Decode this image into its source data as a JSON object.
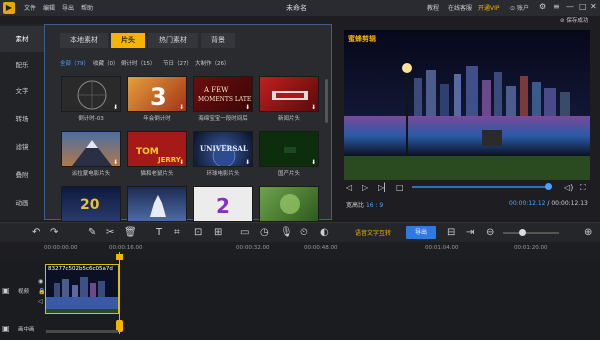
{
  "app": {
    "title": "未命名",
    "menu": [
      "文件",
      "编辑",
      "导出",
      "帮助"
    ],
    "top_right": {
      "tutorial": "教程",
      "online_customer": "在线客服",
      "vip": "开通VIP",
      "account": "账户"
    },
    "save_status": "保存成功"
  },
  "sidebar": {
    "items": [
      "素材",
      "配乐",
      "文字",
      "转场",
      "滤镜",
      "叠附",
      "动画"
    ],
    "active": "素材"
  },
  "library": {
    "tabs": [
      "本地素材",
      "片头",
      "热门素材",
      "背景"
    ],
    "active_tab": "片头",
    "categories": [
      "全部（79）",
      "收藏（0）",
      "倒计时（15）",
      "节日（27）",
      "大制作（26）"
    ],
    "items": [
      {
        "label": "倒计时-03",
        "icon": "circle-countdown-icon"
      },
      {
        "label": "年会倒计时",
        "icon": "number-3-icon"
      },
      {
        "label": "海绵宝宝一段时间后",
        "icon": "title-card-icon"
      },
      {
        "label": "新闻片头",
        "icon": "news-icon"
      },
      {
        "label": "派拉蒙电影片头",
        "icon": "mountain-icon"
      },
      {
        "label": "猫和老鼠片头",
        "icon": "cartoon-icon"
      },
      {
        "label": "环球电影片头",
        "icon": "globe-icon"
      },
      {
        "label": "国产片头",
        "icon": "green-screen-icon"
      },
      {
        "label": "",
        "icon": "20th-century-icon"
      },
      {
        "label": "",
        "icon": "castle-icon"
      },
      {
        "label": "",
        "icon": "number-2-icon"
      },
      {
        "label": "",
        "icon": "nature-icon"
      }
    ],
    "thumb_colors": [
      "#2a2a2a",
      "#c75a2a",
      "#8b1010",
      "#8d1111",
      "#3b3f54",
      "#b21b1b",
      "#1a2a4d",
      "#0f3a0f",
      "#0d1a40",
      "#1d2b52",
      "#e7e7e7",
      "#386b29"
    ]
  },
  "preview": {
    "watermark": "蜜蜂剪辑",
    "ratio_label": "宽高比",
    "ratio": "16 : 9",
    "current_time": "00:00:12.12",
    "total_time": "00:00:12.13",
    "progress": 0.98
  },
  "toolbar": {
    "dub_label": "语音文字互转",
    "export_label": "导出"
  },
  "timeline": {
    "ticks": [
      "00:00:00.00",
      "00:00:16.00",
      "00:00:32.00",
      "00:00:48.00",
      "00:01:04.00",
      "00:01:20.00"
    ],
    "tracks": [
      "视频",
      "画中画"
    ],
    "clip_name": "83277c502b5c6c05a7d",
    "zoom": 0.3
  },
  "colors": {
    "accent": "#f5b400",
    "blue": "#2c7be5",
    "bg": "#1e1e22"
  }
}
